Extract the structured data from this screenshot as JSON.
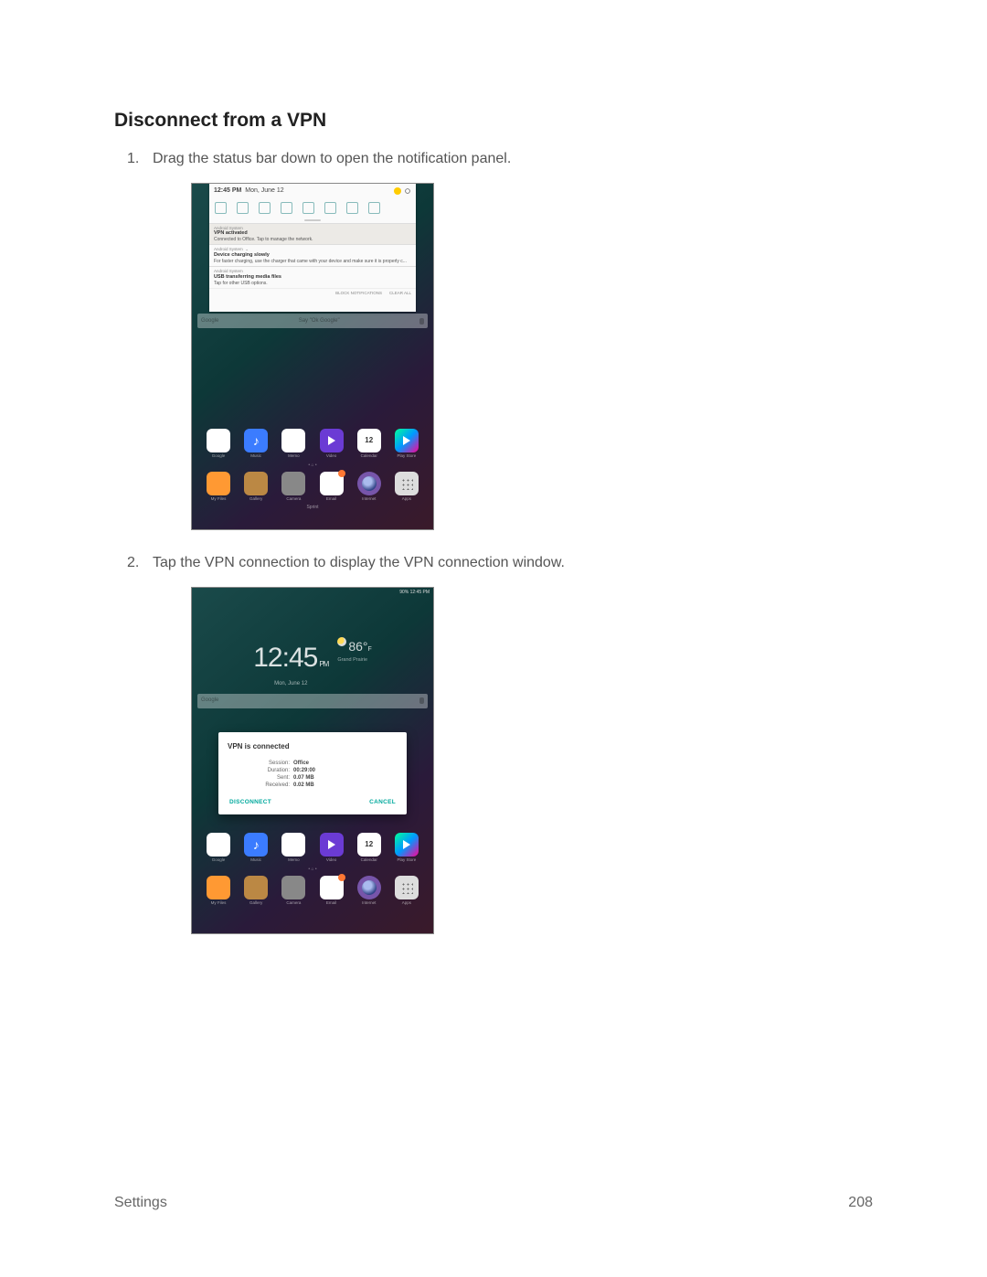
{
  "heading": "Disconnect from a VPN",
  "steps": [
    "Drag the status bar down to open the notification panel.",
    "Tap the VPN connection to display the VPN connection window."
  ],
  "footer": {
    "section": "Settings",
    "page": "208"
  },
  "shot1": {
    "time": "12:45 PM",
    "date": "Mon, June 12",
    "notifs": [
      {
        "src": "Android System",
        "title": "VPN activated",
        "body": "Connected to Office. Tap to manage the network."
      },
      {
        "src": "Android System",
        "title": "Device charging slowly",
        "body": "For faster charging, use the charger that came with your device and make sure it is properly c..."
      },
      {
        "src": "Android System",
        "title": "USB transferring media files",
        "body": "Tap for other USB options."
      }
    ],
    "footer_links": {
      "block": "BLOCK NOTIFICATIONS",
      "clear": "CLEAR ALL"
    },
    "search": {
      "brand": "Google",
      "hint": "Say \"Ok Google\""
    },
    "apps_row1": [
      "Google",
      "Music",
      "Memo",
      "Video",
      "Calendar",
      "Play Store"
    ],
    "apps_row2": [
      "My Files",
      "Gallery",
      "Camera",
      "Email",
      "Internet",
      "Apps"
    ],
    "cal_day": "12",
    "carrier": "Sprint"
  },
  "shot2": {
    "status_right": "90% 12:45 PM",
    "time": "12:45",
    "ampm": "PM",
    "date": "Mon, June 12",
    "temp": "86°",
    "temp_unit": "F",
    "location": "Grand Prairie",
    "dialog": {
      "title": "VPN is connected",
      "rows": [
        {
          "k": "Session:",
          "v": "Office"
        },
        {
          "k": "Duration:",
          "v": "00:29:00"
        },
        {
          "k": "Sent:",
          "v": "0.07 MB"
        },
        {
          "k": "Received:",
          "v": "0.02 MB"
        }
      ],
      "disconnect": "DISCONNECT",
      "cancel": "CANCEL"
    },
    "apps_row1": [
      "Google",
      "Music",
      "Memo",
      "Video",
      "Calendar",
      "Play Store"
    ],
    "apps_row2": [
      "My Files",
      "Gallery",
      "Camera",
      "Email",
      "Internet",
      "Apps"
    ],
    "cal_day": "12"
  }
}
